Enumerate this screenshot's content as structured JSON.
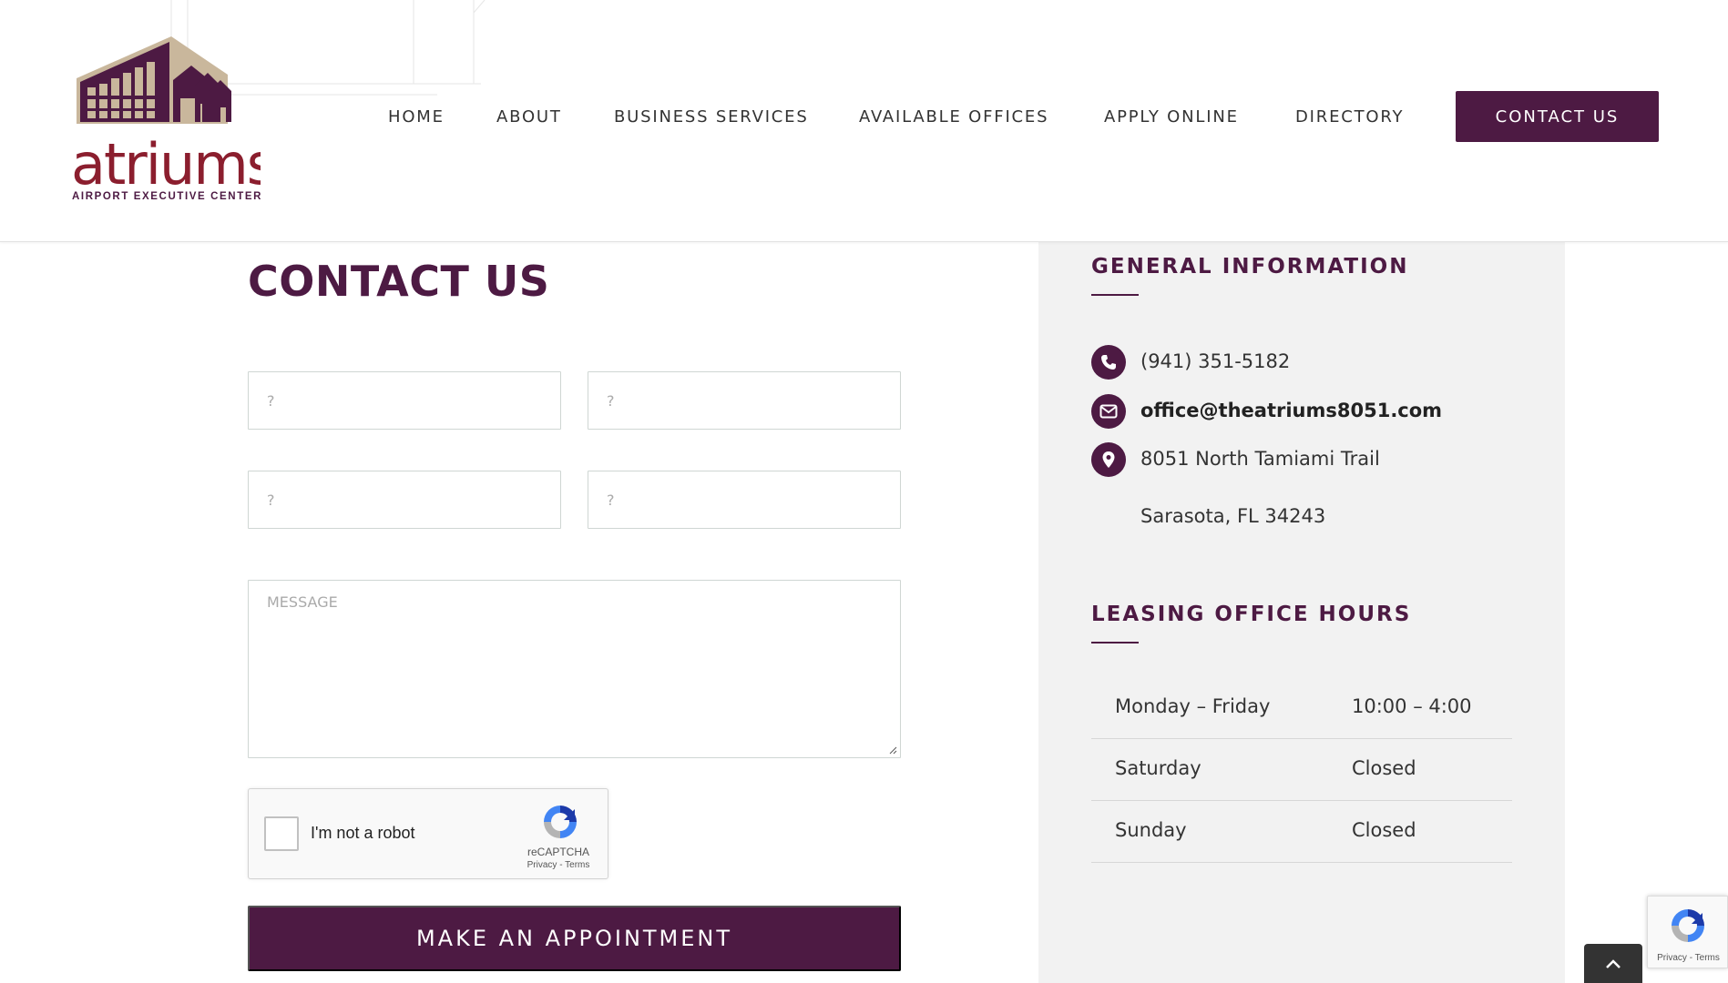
{
  "colors": {
    "brand": "#4d1a43",
    "logo_red": "#8b1e2e",
    "logo_beige": "#c9b79c",
    "sidebar_bg": "#f2f2f2"
  },
  "logo": {
    "wordmark": "atriums",
    "subtitle": "AIRPORT EXECUTIVE CENTER"
  },
  "nav": {
    "items": [
      "HOME",
      "ABOUT",
      "BUSINESS SERVICES",
      "AVAILABLE OFFICES",
      "APPLY ONLINE",
      "DIRECTORY"
    ],
    "cta": "CONTACT US"
  },
  "main": {
    "title": "CONTACT US",
    "form": {
      "field_placeholders": [
        "?",
        "?",
        "?",
        "?"
      ],
      "message_placeholder": "MESSAGE",
      "captcha": {
        "label": "I'm not a robot",
        "brand": "reCAPTCHA",
        "links": "Privacy - Terms"
      },
      "submit_label": "MAKE AN APPOINTMENT"
    }
  },
  "sidebar": {
    "general_heading": "GENERAL INFORMATION",
    "phone": "(941) 351-5182",
    "email": "office@theatriums8051.com",
    "address_line1": "8051 North Tamiami Trail",
    "address_line2": "Sarasota, FL 34243",
    "hours_heading": "LEASING OFFICE HOURS",
    "hours": [
      {
        "day": "Monday – Friday",
        "time": "10:00 – 4:00"
      },
      {
        "day": "Saturday",
        "time": "Closed"
      },
      {
        "day": "Sunday",
        "time": "Closed"
      }
    ]
  },
  "recaptcha_badge": {
    "links": "Privacy - Terms"
  },
  "icons": [
    "phone-icon",
    "envelope-icon",
    "map-pin-icon",
    "chevron-up-icon",
    "recaptcha-icon"
  ]
}
